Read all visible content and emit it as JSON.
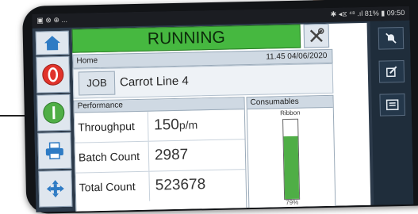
{
  "status_bar": {
    "left_icons": "▣ ⊗ ⊕ ...",
    "right_text": "✱ ◂⧖ ⁴⁸ .ıl 81% ▮ 09:50"
  },
  "header": {
    "state": "RUNNING",
    "page": "Home",
    "datetime": "11.45 04/06/2020"
  },
  "job": {
    "button_label": "JOB",
    "name": "Carrot Line 4"
  },
  "performance": {
    "title": "Performance",
    "rows": [
      {
        "label": "Throughput",
        "value": "150",
        "unit": "p/m"
      },
      {
        "label": "Batch Count",
        "value": "2987",
        "unit": ""
      },
      {
        "label": "Total Count",
        "value": "523678",
        "unit": ""
      }
    ]
  },
  "consumables": {
    "title": "Consumables",
    "item": "Ribbon",
    "level_percent": 79,
    "level_label": "79%"
  },
  "sidebar_icons": [
    "home-icon",
    "stop-icon",
    "start-icon",
    "print-icon",
    "move-icon"
  ],
  "rightbar_icons": [
    "mute-alarm-icon",
    "edit-icon",
    "keyboard-icon"
  ],
  "colors": {
    "running_green": "#46b840",
    "stop_red": "#e0332b",
    "start_green": "#4fae46",
    "home_blue": "#2e7bc4"
  }
}
